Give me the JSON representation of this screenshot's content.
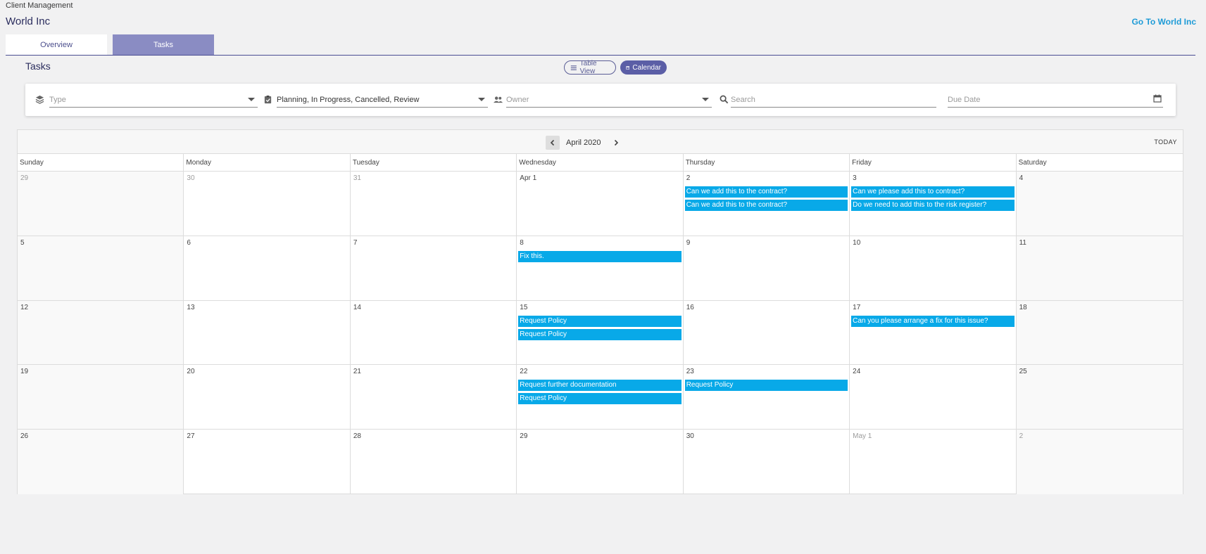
{
  "header": {
    "breadcrumb": "Client Management",
    "title": "World Inc",
    "goto_link": "Go To World Inc"
  },
  "tabs": [
    {
      "label": "Overview",
      "active": false
    },
    {
      "label": "Tasks",
      "active": true
    }
  ],
  "section_title": "Tasks",
  "view_toggle": {
    "table_label": "Table View",
    "calendar_label": "Calendar",
    "active": "calendar"
  },
  "filters": {
    "type_placeholder": "Type",
    "status_value": "Planning, In Progress, Cancelled, Review",
    "owner_placeholder": "Owner",
    "search_placeholder": "Search",
    "due_date_placeholder": "Due Date"
  },
  "calendar": {
    "month_label": "April 2020",
    "today_label": "TODAY",
    "weekdays": [
      "Sunday",
      "Monday",
      "Tuesday",
      "Wednesday",
      "Thursday",
      "Friday",
      "Saturday"
    ],
    "days": [
      {
        "label": "29",
        "other": true,
        "events": []
      },
      {
        "label": "30",
        "other": true,
        "events": []
      },
      {
        "label": "31",
        "other": true,
        "events": []
      },
      {
        "label": "Apr 1",
        "other": false,
        "events": []
      },
      {
        "label": "2",
        "other": false,
        "events": [
          "Can we add this to the contract?",
          "Can we add this to the contract?"
        ]
      },
      {
        "label": "3",
        "other": false,
        "events": [
          "Can we please add this to contract?",
          "Do we need to add this to the risk register?"
        ]
      },
      {
        "label": "4",
        "other": false,
        "events": []
      },
      {
        "label": "5",
        "other": false,
        "events": []
      },
      {
        "label": "6",
        "other": false,
        "events": []
      },
      {
        "label": "7",
        "other": false,
        "events": []
      },
      {
        "label": "8",
        "other": false,
        "events": [
          "Fix this."
        ]
      },
      {
        "label": "9",
        "other": false,
        "events": []
      },
      {
        "label": "10",
        "other": false,
        "events": []
      },
      {
        "label": "11",
        "other": false,
        "events": []
      },
      {
        "label": "12",
        "other": false,
        "events": []
      },
      {
        "label": "13",
        "other": false,
        "events": []
      },
      {
        "label": "14",
        "other": false,
        "events": []
      },
      {
        "label": "15",
        "other": false,
        "events": [
          "Request Policy",
          "Request Policy"
        ]
      },
      {
        "label": "16",
        "other": false,
        "events": []
      },
      {
        "label": "17",
        "other": false,
        "events": [
          "Can you please arrange a fix for this issue?"
        ]
      },
      {
        "label": "18",
        "other": false,
        "events": []
      },
      {
        "label": "19",
        "other": false,
        "events": []
      },
      {
        "label": "20",
        "other": false,
        "events": []
      },
      {
        "label": "21",
        "other": false,
        "events": []
      },
      {
        "label": "22",
        "other": false,
        "events": [
          "Request further documentation",
          "Request Policy"
        ]
      },
      {
        "label": "23",
        "other": false,
        "events": [
          "Request Policy"
        ]
      },
      {
        "label": "24",
        "other": false,
        "events": []
      },
      {
        "label": "25",
        "other": false,
        "events": []
      },
      {
        "label": "26",
        "other": false,
        "events": []
      },
      {
        "label": "27",
        "other": false,
        "events": []
      },
      {
        "label": "28",
        "other": false,
        "events": []
      },
      {
        "label": "29",
        "other": false,
        "events": []
      },
      {
        "label": "30",
        "other": false,
        "events": []
      },
      {
        "label": "May 1",
        "other": true,
        "events": []
      },
      {
        "label": "2",
        "other": true,
        "events": []
      }
    ]
  },
  "colors": {
    "accent": "#5b5ea6",
    "event": "#08a9e8",
    "link": "#1e9bd7"
  }
}
